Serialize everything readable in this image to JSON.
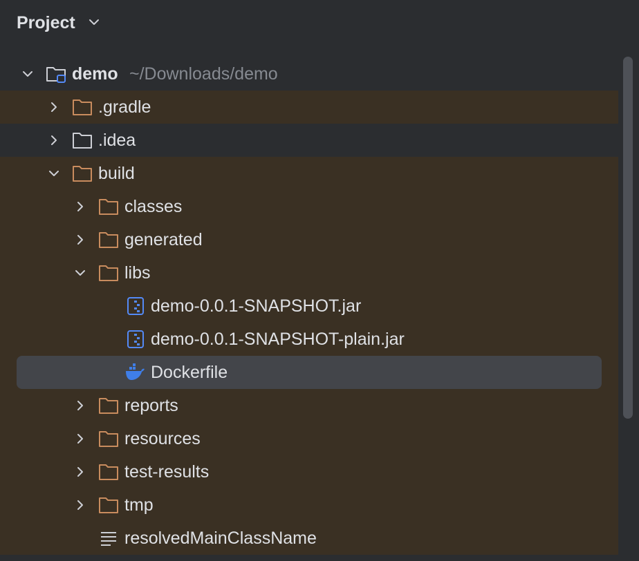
{
  "panel": {
    "title": "Project"
  },
  "root": {
    "name": "demo",
    "path": "~/Downloads/demo"
  },
  "tree": {
    "items": [
      {
        "label": ".gradle"
      },
      {
        "label": ".idea"
      },
      {
        "label": "build"
      },
      {
        "label": "classes"
      },
      {
        "label": "generated"
      },
      {
        "label": "libs"
      },
      {
        "label": "demo-0.0.1-SNAPSHOT.jar"
      },
      {
        "label": "demo-0.0.1-SNAPSHOT-plain.jar"
      },
      {
        "label": "Dockerfile"
      },
      {
        "label": "reports"
      },
      {
        "label": "resources"
      },
      {
        "label": "test-results"
      },
      {
        "label": "tmp"
      },
      {
        "label": "resolvedMainClassName"
      }
    ]
  },
  "colors": {
    "background": "#2b2d30",
    "excluded_row": "#3a3023",
    "selected_row": "#43454a",
    "folder_excluded": "#c98c5e",
    "folder_plain": "#ced0d6",
    "jar_blue": "#548af7",
    "docker_blue": "#3f7ee8"
  }
}
